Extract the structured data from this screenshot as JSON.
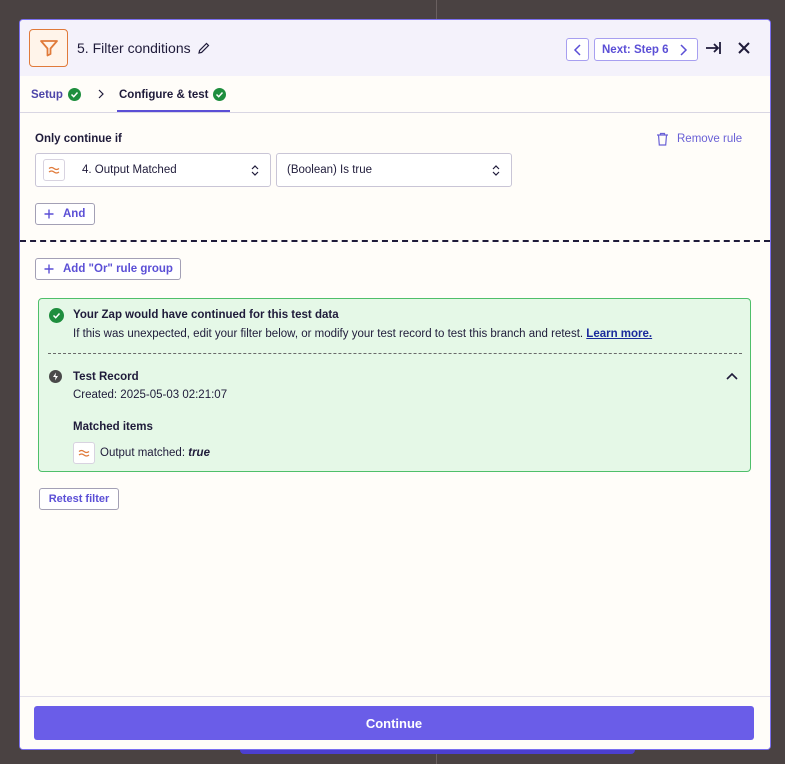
{
  "header": {
    "title": "5. Filter conditions",
    "next_label": "Next: Step 6"
  },
  "tabs": [
    {
      "label": "Setup",
      "complete": true
    },
    {
      "label": "Configure & test",
      "complete": true,
      "active": true
    }
  ],
  "rule": {
    "only_label": "Only continue if",
    "remove_label": "Remove rule",
    "field_value": "4. Output Matched",
    "operator_value": "(Boolean) Is true",
    "and_label": "And",
    "or_label": "Add \"Or\" rule group"
  },
  "result": {
    "title": "Your Zap would have continued for this test data",
    "description": "If this was unexpected, edit your filter below, or modify your test record to test this branch and retest.",
    "learn_more": "Learn more.",
    "record_title": "Test Record",
    "record_created": "Created: 2025-05-03 02:21:07",
    "matched_title": "Matched items",
    "matched_label": "Output matched:",
    "matched_value": "true"
  },
  "retest_label": "Retest filter",
  "continue_label": "Continue",
  "colors": {
    "accent": "#6a5de8",
    "success": "#1e8e3e",
    "success_bg": "#e5f8e7",
    "filter_brand": "#e07a3a"
  },
  "icons": [
    "filter-icon",
    "pencil-icon",
    "chevron-left-icon",
    "chevron-right-icon",
    "collapse-panel-icon",
    "close-icon",
    "check-icon",
    "trash-icon",
    "formatter-icon",
    "up-down-icon",
    "plus-icon",
    "bolt-icon",
    "chevron-up-icon"
  ]
}
